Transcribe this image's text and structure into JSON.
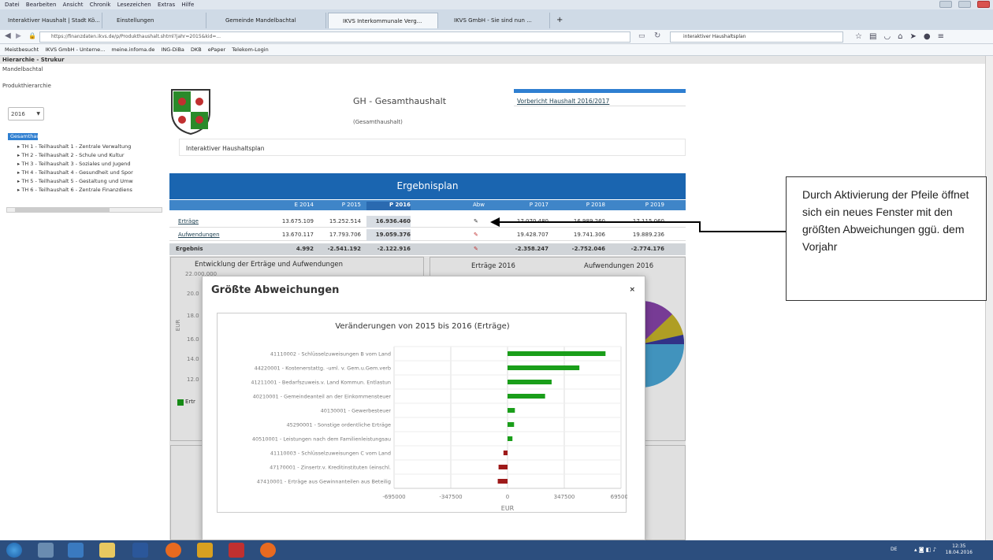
{
  "menubar": {
    "items": [
      "Datei",
      "Bearbeiten",
      "Ansicht",
      "Chronik",
      "Lesezeichen",
      "Extras",
      "Hilfe"
    ]
  },
  "tabs": [
    {
      "label": "Interaktiver Haushalt | Stadt Kö... ×"
    },
    {
      "label": "Einstellungen"
    },
    {
      "label": "Gemeinde Mandelbachtal"
    },
    {
      "label": "IKVS Interkommunale Verg..."
    },
    {
      "label": "IKVS GmbH - Sie sind nun ..."
    }
  ],
  "tab_new": "+",
  "url": "https://finanzdaten.ikvs.de/p/Produkthaushalt.shtml?jahr=2015&kid=...",
  "search": {
    "value": "interaktiver Haushaltsplan"
  },
  "bookmarks": [
    "Meistbesucht",
    "IKVS GmbH - Unterne...",
    "meine.infoma.de",
    "ING-DiBa",
    "DKB",
    "ePaper",
    "Telekom-Login"
  ],
  "hier_header": "Hierarchie - Strukur",
  "sidebar": {
    "org": "Mandelbachtal",
    "label_hier": "Produkthierarchie",
    "year": "2016",
    "root": "Gesamthaushalt",
    "items": [
      "TH 1 - Teilhaushalt 1 - Zentrale Verwaltung",
      "TH 2 - Teilhaushalt 2 - Schule und Kultur",
      "TH 3 - Teilhaushalt 3 - Soziales und Jugend",
      "TH 4 - Teilhaushalt 4 - Gesundheit und Spor",
      "TH 5 - Teilhaushalt 5 - Gestaltung und Umw",
      "TH 6 - Teilhaushalt 6 - Zentrale Finanzdiens"
    ]
  },
  "header": {
    "title": "GH - Gesamthaushalt",
    "subtitle": "(Gesamthaushalt)",
    "report_link": "Vorbericht Haushalt 2016/2017",
    "plan_label": "Interaktiver Haushaltsplan"
  },
  "plan": {
    "title": "Ergebnisplan",
    "columns": [
      "E 2014",
      "P 2015",
      "P 2016",
      "Abw",
      "P 2017",
      "P 2018",
      "P 2019"
    ],
    "rows": [
      {
        "name": "Erträge",
        "values": [
          "13.675.109",
          "15.252.514",
          "16.936.460",
          "",
          "17.070.480",
          "16.989.260",
          "17.115.060"
        ]
      },
      {
        "name": "Aufwendungen",
        "values": [
          "13.670.117",
          "17.793.706",
          "19.059.376",
          "",
          "19.428.707",
          "19.741.306",
          "19.889.236"
        ]
      },
      {
        "name": "Ergebnis",
        "values": [
          "4.992",
          "-2.541.192",
          "-2.122.916",
          "",
          "-2.358.247",
          "-2.752.046",
          "-2.774.176"
        ]
      }
    ]
  },
  "panels": {
    "left_title": "Entwicklung der Erträge und Aufwendungen",
    "ertraege_2016": "Erträge 2016",
    "aufw_2016": "Aufwendungen 2016",
    "ylabel": "EUR",
    "yticks": [
      "22.000.000",
      "20.0",
      "18.0",
      "16.0",
      "14.0",
      "12.0"
    ],
    "legend": "Ertr"
  },
  "modal": {
    "title": "Größte Abweichungen",
    "close": "×"
  },
  "chart_data": {
    "type": "bar",
    "orientation": "horizontal",
    "title": "Veränderungen von 2015 bis 2016 (Erträge)",
    "xlabel": "EUR",
    "xlim": [
      -695000,
      695000
    ],
    "xticks": [
      "-695000",
      "-347500",
      "0",
      "347500",
      "695000"
    ],
    "categories": [
      "41110002 - Schlüsselzuweisungen B vom Land",
      "44220001 - Kostenerstattg. -uml. v. Gem.u.Gem.verb",
      "41211001 - Bedarfszuweis.v. Land Kommun. Entlastun",
      "40210001 - Gemeindeanteil an der Einkommensteuer",
      "40130001 - Gewerbesteuer",
      "45290001 - Sonstige ordentliche Erträge",
      "40510001 - Leistungen nach dem Familienleistungsau",
      "41110003 - Schlüsselzuweisungen C vom Land",
      "47170001 - Zinsertr.v. Kreditinstituten (einschl.",
      "47410001 - Erträge aus Gewinnanteilen aus Beteilig"
    ],
    "values": [
      600000,
      440000,
      270000,
      230000,
      45000,
      40000,
      30000,
      -25000,
      -55000,
      -60000
    ],
    "colors": {
      "positive": "#1a9e1a",
      "negative": "#9e1a1a"
    },
    "grid": true
  },
  "annotation": "Durch Aktivierung der Pfeile öffnet sich ein neues Fenster mit den größten Abweichungen ggü. dem Vorjahr",
  "clock": {
    "time": "12:35",
    "date": "18.04.2016"
  },
  "tray": "DE"
}
